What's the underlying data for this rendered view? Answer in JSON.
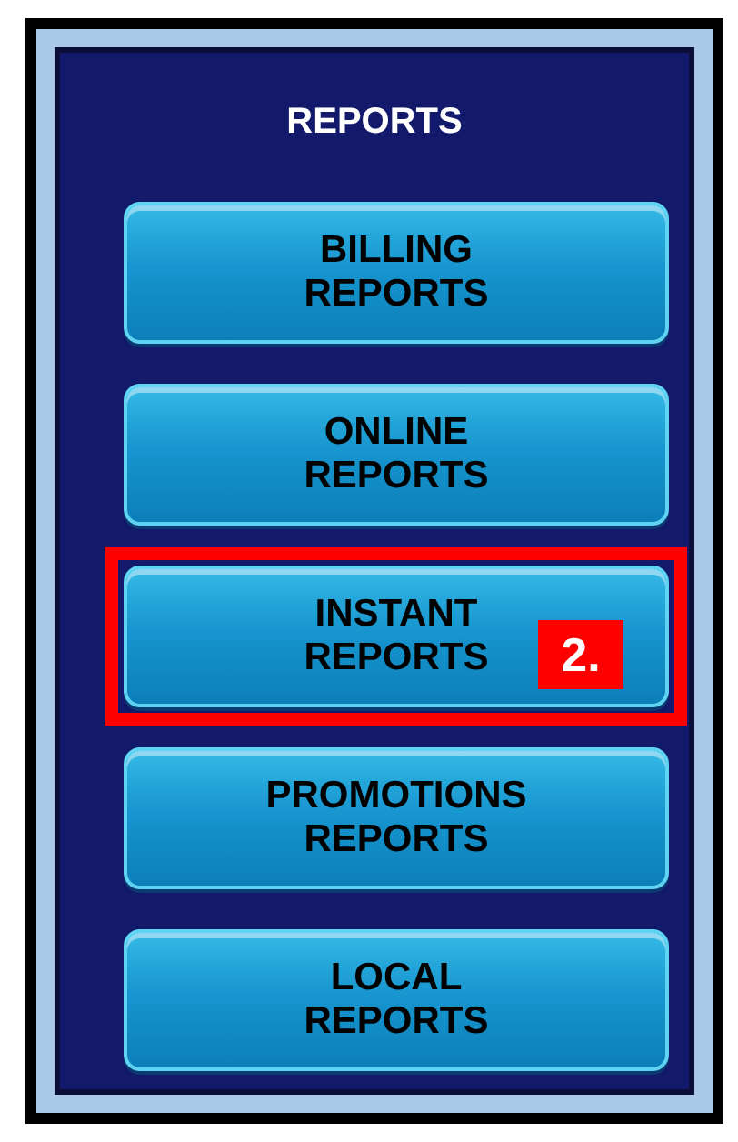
{
  "menu": {
    "title": "REPORTS",
    "buttons": [
      {
        "label": "BILLING\nREPORTS",
        "highlighted": false
      },
      {
        "label": "ONLINE\nREPORTS",
        "highlighted": false
      },
      {
        "label": "INSTANT\nREPORTS",
        "highlighted": true,
        "callout": "2."
      },
      {
        "label": "PROMOTIONS\nREPORTS",
        "highlighted": false
      },
      {
        "label": "LOCAL\nREPORTS",
        "highlighted": false
      }
    ]
  }
}
